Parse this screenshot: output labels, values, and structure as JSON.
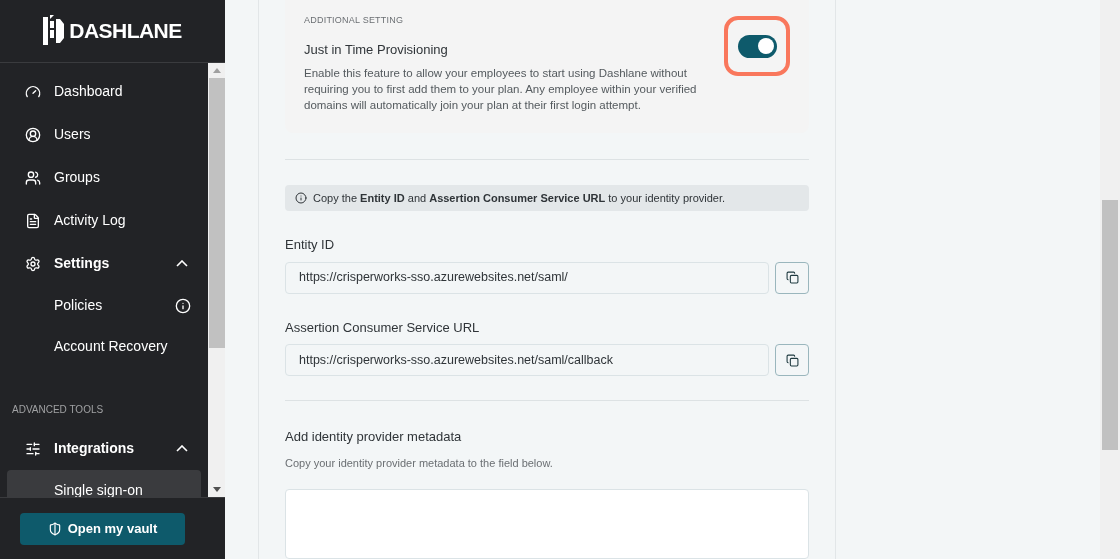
{
  "sidebar": {
    "logo": "DASHLANE",
    "items": [
      {
        "label": "Dashboard",
        "selected": false
      },
      {
        "label": "Users",
        "selected": false
      },
      {
        "label": "Groups",
        "selected": false
      },
      {
        "label": "Activity Log",
        "selected": false
      },
      {
        "label": "Settings",
        "selected": false,
        "expanded": true,
        "children": [
          {
            "label": "Policies",
            "info": true,
            "selected": false
          },
          {
            "label": "Account Recovery",
            "info": false,
            "selected": false
          }
        ]
      }
    ],
    "section_label": "ADVANCED TOOLS",
    "advanced_items": [
      {
        "label": "Integrations",
        "selected": false,
        "expanded": true,
        "children": [
          {
            "label": "Single sign-on",
            "info": false,
            "selected": true
          }
        ]
      }
    ],
    "vault_button": "Open my vault"
  },
  "main": {
    "setting": {
      "eyebrow": "ADDITIONAL SETTING",
      "title": "Just in Time Provisioning",
      "description": "Enable this feature to allow your employees to start using Dashlane without requiring you to first add them to your plan. Any employee within your verified domains will automatically join your plan at their first login attempt.",
      "on": true,
      "highlighted": true
    },
    "notice": "Copy the **Entity ID** and **Assertion Consumer Service URL** to your identity provider.",
    "fields": [
      {
        "label": "Entity ID",
        "value": "https://crisperworks-sso.azurewebsites.net/saml/"
      },
      {
        "label": "Assertion Consumer Service URL",
        "value": "https://crisperworks-sso.azurewebsites.net/saml/callback"
      }
    ],
    "metadata": {
      "title": "Add identity provider metadata",
      "hint": "Copy your identity provider metadata to the field below."
    }
  }
}
